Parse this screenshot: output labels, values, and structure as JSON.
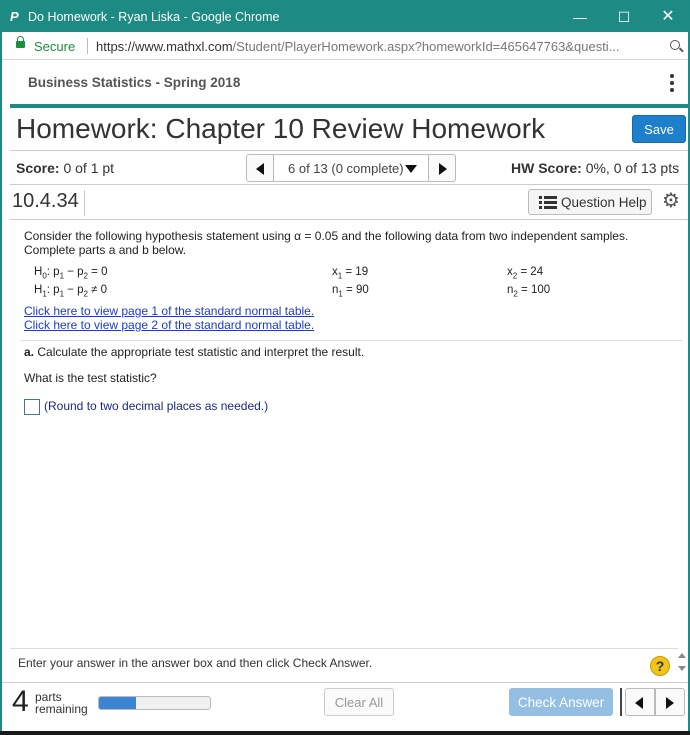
{
  "window": {
    "title": "Do Homework - Ryan Liska - Google Chrome",
    "app_icon_glyph": "P",
    "accent": "#1d8a84",
    "controls": {
      "minimize": "—",
      "maximize": "☐",
      "close": "✕"
    }
  },
  "address_bar": {
    "secure_label": "Secure",
    "url_host": "https://www.mathxl.com",
    "url_path": "/Student/PlayerHomework.aspx?homeworkId=465647763&questi..."
  },
  "course": {
    "title": "Business Statistics - Spring 2018"
  },
  "homework": {
    "title": "Homework: Chapter 10 Review Homework",
    "save_label": "Save",
    "score_label": "Score:",
    "score_value": "0 of 1 pt",
    "nav_label": "6 of 13 (0 complete)",
    "hw_score_label": "HW Score:",
    "hw_score_value": "0%, 0 of 13 pts"
  },
  "question": {
    "number": "10.4.34",
    "help_label": "Question Help",
    "prompt": "Consider the following hypothesis statement using α = 0.05 and the following data from two independent samples. Complete parts a and b below.",
    "h0_lhs": "H",
    "h0_sub": "0",
    "h0_expr_a": ": p",
    "h0_expr_sub1": "1",
    "h0_expr_b": " − p",
    "h0_expr_sub2": "2",
    "h0_rhs": " = 0",
    "h1_lhs": "H",
    "h1_sub": "1",
    "h1_expr_a": ": p",
    "h1_expr_sub1": "1",
    "h1_expr_b": " − p",
    "h1_expr_sub2": "2",
    "h1_rhs": " ≠ 0",
    "x1_var": "x",
    "x1_sub": "1",
    "x1_val": " = 19",
    "n1_var": "n",
    "n1_sub": "1",
    "n1_val": " = 90",
    "x2_var": "x",
    "x2_sub": "2",
    "x2_val": " = 24",
    "n2_var": "n",
    "n2_sub": "2",
    "n2_val": " = 100",
    "link1": "Click here to view page 1 of the standard normal table.",
    "link2": "Click here to view page 2 of the standard normal table.",
    "part_a_label": "a.",
    "part_a_text": " Calculate the appropriate test statistic and interpret the result.",
    "sub_question": "What is the test statistic?",
    "answer_value": "",
    "round_note": "(Round to two decimal places as needed.)"
  },
  "footer": {
    "instruction": "Enter your answer in the answer box and then click Check Answer.",
    "help_glyph": "?",
    "parts_count": "4",
    "parts_line1": "parts",
    "parts_line2": "remaining",
    "progress_fraction": 0.33,
    "clear_label": "Clear All",
    "check_label": "Check Answer"
  }
}
